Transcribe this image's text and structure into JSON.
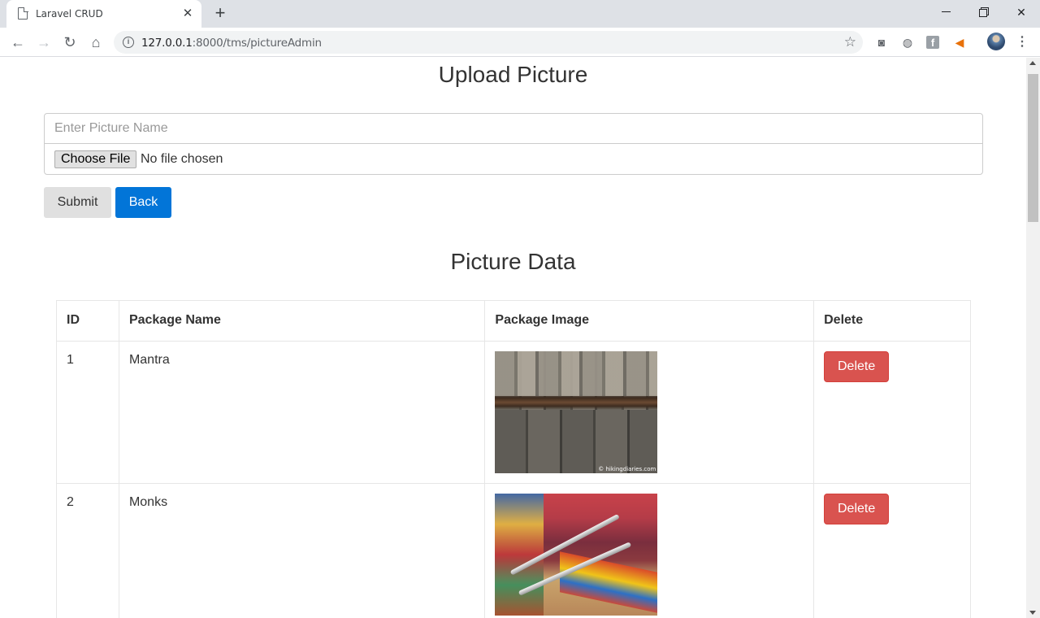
{
  "browser": {
    "tab_title": "Laravel CRUD",
    "url_host": "127.0.0.1",
    "url_path": ":8000/tms/pictureAdmin"
  },
  "upload": {
    "heading": "Upload Picture",
    "name_placeholder": "Enter Picture Name",
    "choose_file_label": "Choose File",
    "no_file_text": "No file chosen",
    "submit_label": "Submit",
    "back_label": "Back"
  },
  "table": {
    "heading": "Picture Data",
    "headers": [
      "ID",
      "Package Name",
      "Package Image",
      "Delete"
    ],
    "rows": [
      {
        "id": "1",
        "name": "Mantra",
        "image_caption": "© hikingdiaries.com",
        "delete_label": "Delete"
      },
      {
        "id": "2",
        "name": "Monks",
        "delete_label": "Delete"
      }
    ]
  },
  "colors": {
    "primary": "#0275d8",
    "danger": "#d9534f",
    "default_button": "#e0e0e0"
  }
}
